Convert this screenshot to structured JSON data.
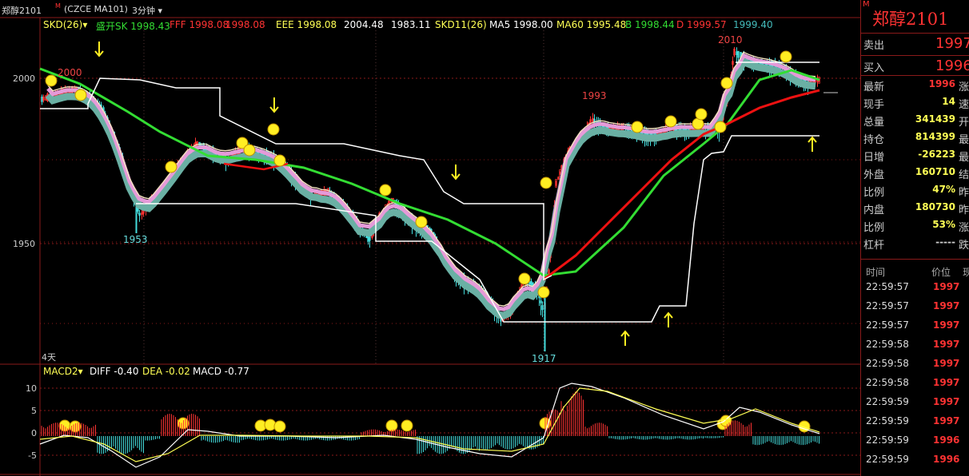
{
  "header": {
    "symbol": "郑醇2101",
    "code": "(CZCE MA101)",
    "period": "3分钟"
  },
  "indicators": {
    "name": "SKD(26)",
    "items": [
      {
        "label": "盛开SK 1998.43",
        "color": "#33dd33"
      },
      {
        "label": "FFF 1998.08",
        "color": "#ff3333"
      },
      {
        "label": "1998.08",
        "color": "#ff3333"
      },
      {
        "label": "EEE 1998.08",
        "color": "#ffff55"
      },
      {
        "label": "2004.48",
        "color": "#ffffff"
      },
      {
        "label": "1983.11",
        "color": "#ffffff"
      },
      {
        "label": "SKD11(26)",
        "color": "#ffff55"
      },
      {
        "label": "MA5 1998.00",
        "color": "#ffffff"
      },
      {
        "label": "MA60 1995.48",
        "color": "#ffff55"
      },
      {
        "label": "B 1998.44",
        "color": "#33dd33"
      },
      {
        "label": "D 1999.57",
        "color": "#ff3333"
      },
      {
        "label": "1999.40",
        "color": "#44bbbb"
      }
    ]
  },
  "price_axis": {
    "labels": [
      "2000",
      "1950"
    ]
  },
  "chart_labels": {
    "high_left": "2000",
    "low_left": "1953",
    "mid_high": "1993",
    "low_mid": "1917",
    "high_right": "2010",
    "days": "4天"
  },
  "macd": {
    "name": "MACD2",
    "diff": "DIFF -0.40",
    "dea": "DEA -0.02",
    "macd": "MACD -0.77",
    "axis": [
      "10",
      "5",
      "0",
      "-5"
    ]
  },
  "quote": {
    "title": "郑醇2101",
    "marker": "M",
    "sell_label": "卖出",
    "sell_price": "1997",
    "buy_label": "买入",
    "buy_price": "1996",
    "rows": [
      {
        "label": "最新",
        "value": "1996",
        "color": "#ff3333",
        "extra": "涨"
      },
      {
        "label": "现手",
        "value": "14",
        "color": "#ffff55",
        "extra": "速"
      },
      {
        "label": "总量",
        "value": "341439",
        "color": "#ffff55",
        "extra": "开"
      },
      {
        "label": "持仓",
        "value": "814399",
        "color": "#ffff55",
        "extra": "最"
      },
      {
        "label": "日增",
        "value": "-26223",
        "color": "#ffff55",
        "extra": "最"
      },
      {
        "label": "外盘",
        "value": "160710",
        "color": "#ffff55",
        "extra": "结"
      },
      {
        "label": "比例",
        "value": "47%",
        "color": "#ffff55",
        "extra": "昨"
      },
      {
        "label": "内盘",
        "value": "180730",
        "color": "#ffff55",
        "extra": "昨"
      },
      {
        "label": "比例",
        "value": "53%",
        "color": "#ffff55",
        "extra": "涨"
      },
      {
        "label": "杠杆",
        "value": "-----",
        "color": "#cccccc",
        "extra": "跌"
      }
    ],
    "trade_header": {
      "time": "时间",
      "price": "价位",
      "vol": "现"
    },
    "trades": [
      {
        "time": "22:59:57",
        "price": "1997"
      },
      {
        "time": "22:59:57",
        "price": "1997"
      },
      {
        "time": "22:59:57",
        "price": "1997"
      },
      {
        "time": "22:59:58",
        "price": "1997"
      },
      {
        "time": "22:59:58",
        "price": "1997"
      },
      {
        "time": "22:59:58",
        "price": "1997"
      },
      {
        "time": "22:59:59",
        "price": "1997"
      },
      {
        "time": "22:59:59",
        "price": "1997"
      },
      {
        "time": "22:59:59",
        "price": "1996"
      },
      {
        "time": "22:59:59",
        "price": "1996"
      }
    ]
  },
  "colors": {
    "up": "#ff3333",
    "down": "#44dddd",
    "ma_green": "#33dd33",
    "ma_red": "#ee1111",
    "grid": "#8a1a1a"
  }
}
